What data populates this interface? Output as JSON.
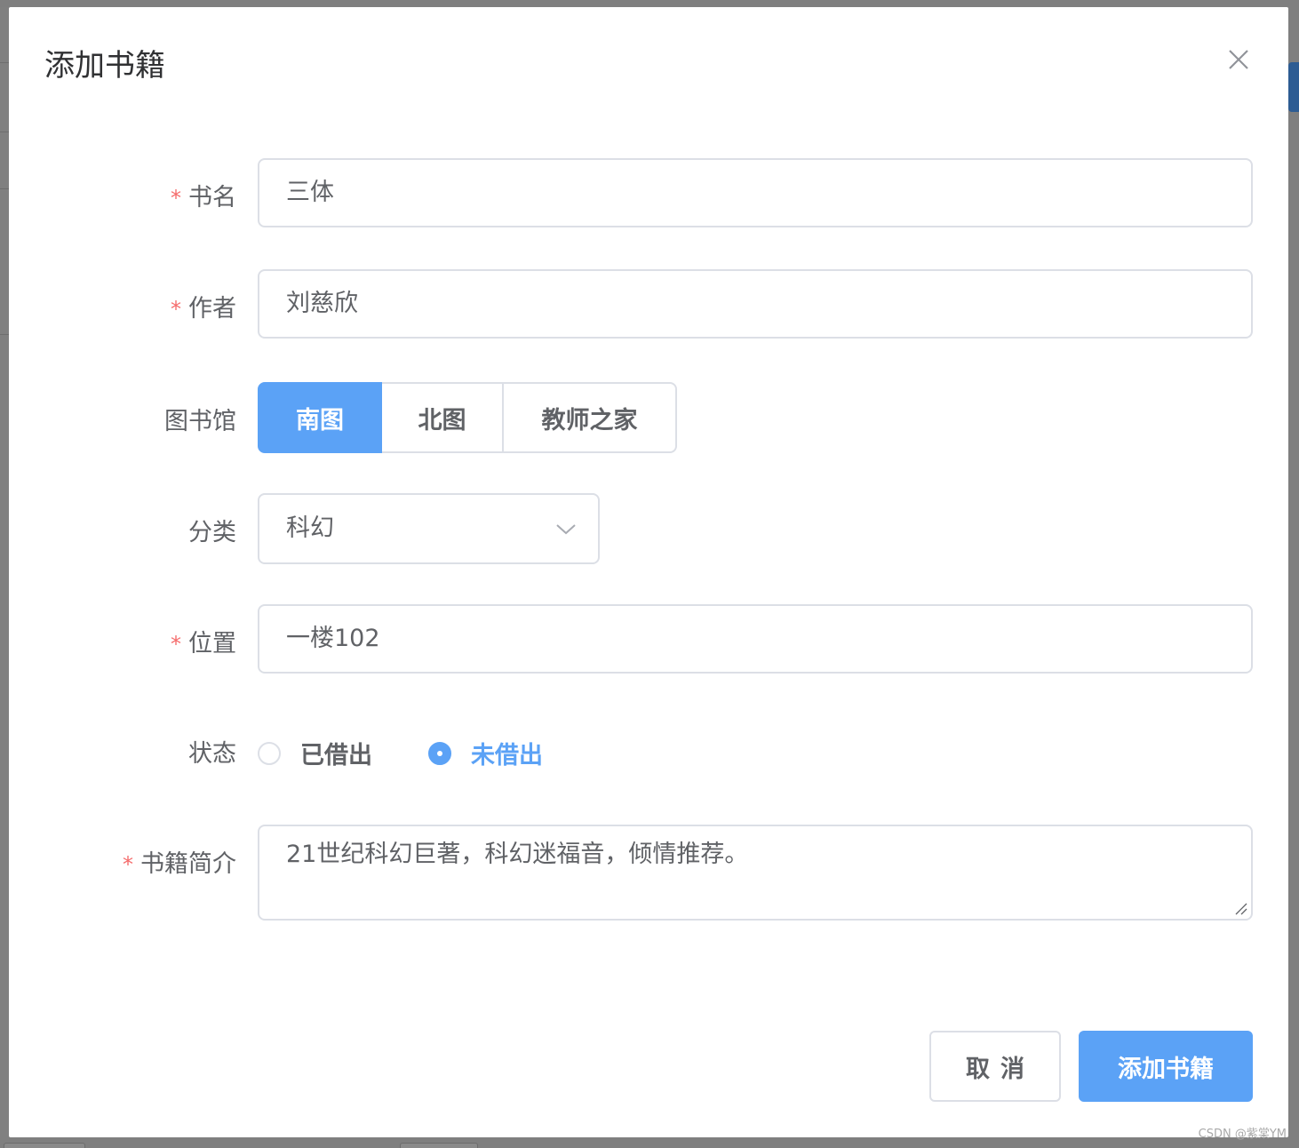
{
  "dialog": {
    "title": "添加书籍",
    "close_icon": "close-icon"
  },
  "form": {
    "book_name": {
      "label": "书名",
      "required": true,
      "value": "三体"
    },
    "author": {
      "label": "作者",
      "required": true,
      "value": "刘慈欣"
    },
    "library": {
      "label": "图书馆",
      "options": [
        "南图",
        "北图",
        "教师之家"
      ],
      "selected": "南图"
    },
    "category": {
      "label": "分类",
      "value": "科幻",
      "icon": "chevron-down-icon"
    },
    "location": {
      "label": "位置",
      "required": true,
      "value": "一楼102"
    },
    "status": {
      "label": "状态",
      "options": [
        "已借出",
        "未借出"
      ],
      "selected": "未借出"
    },
    "intro": {
      "label": "书籍简介",
      "required": true,
      "value": "21世纪科幻巨著，科幻迷福音，倾情推荐。"
    }
  },
  "footer": {
    "cancel_label": "取消",
    "submit_label": "添加书籍"
  },
  "watermark": "CSDN @紫棠YM",
  "colors": {
    "primary": "#5ba2f6",
    "required": "#f56c6c",
    "border": "#dcdfe6",
    "text": "#606266",
    "title": "#303133"
  }
}
